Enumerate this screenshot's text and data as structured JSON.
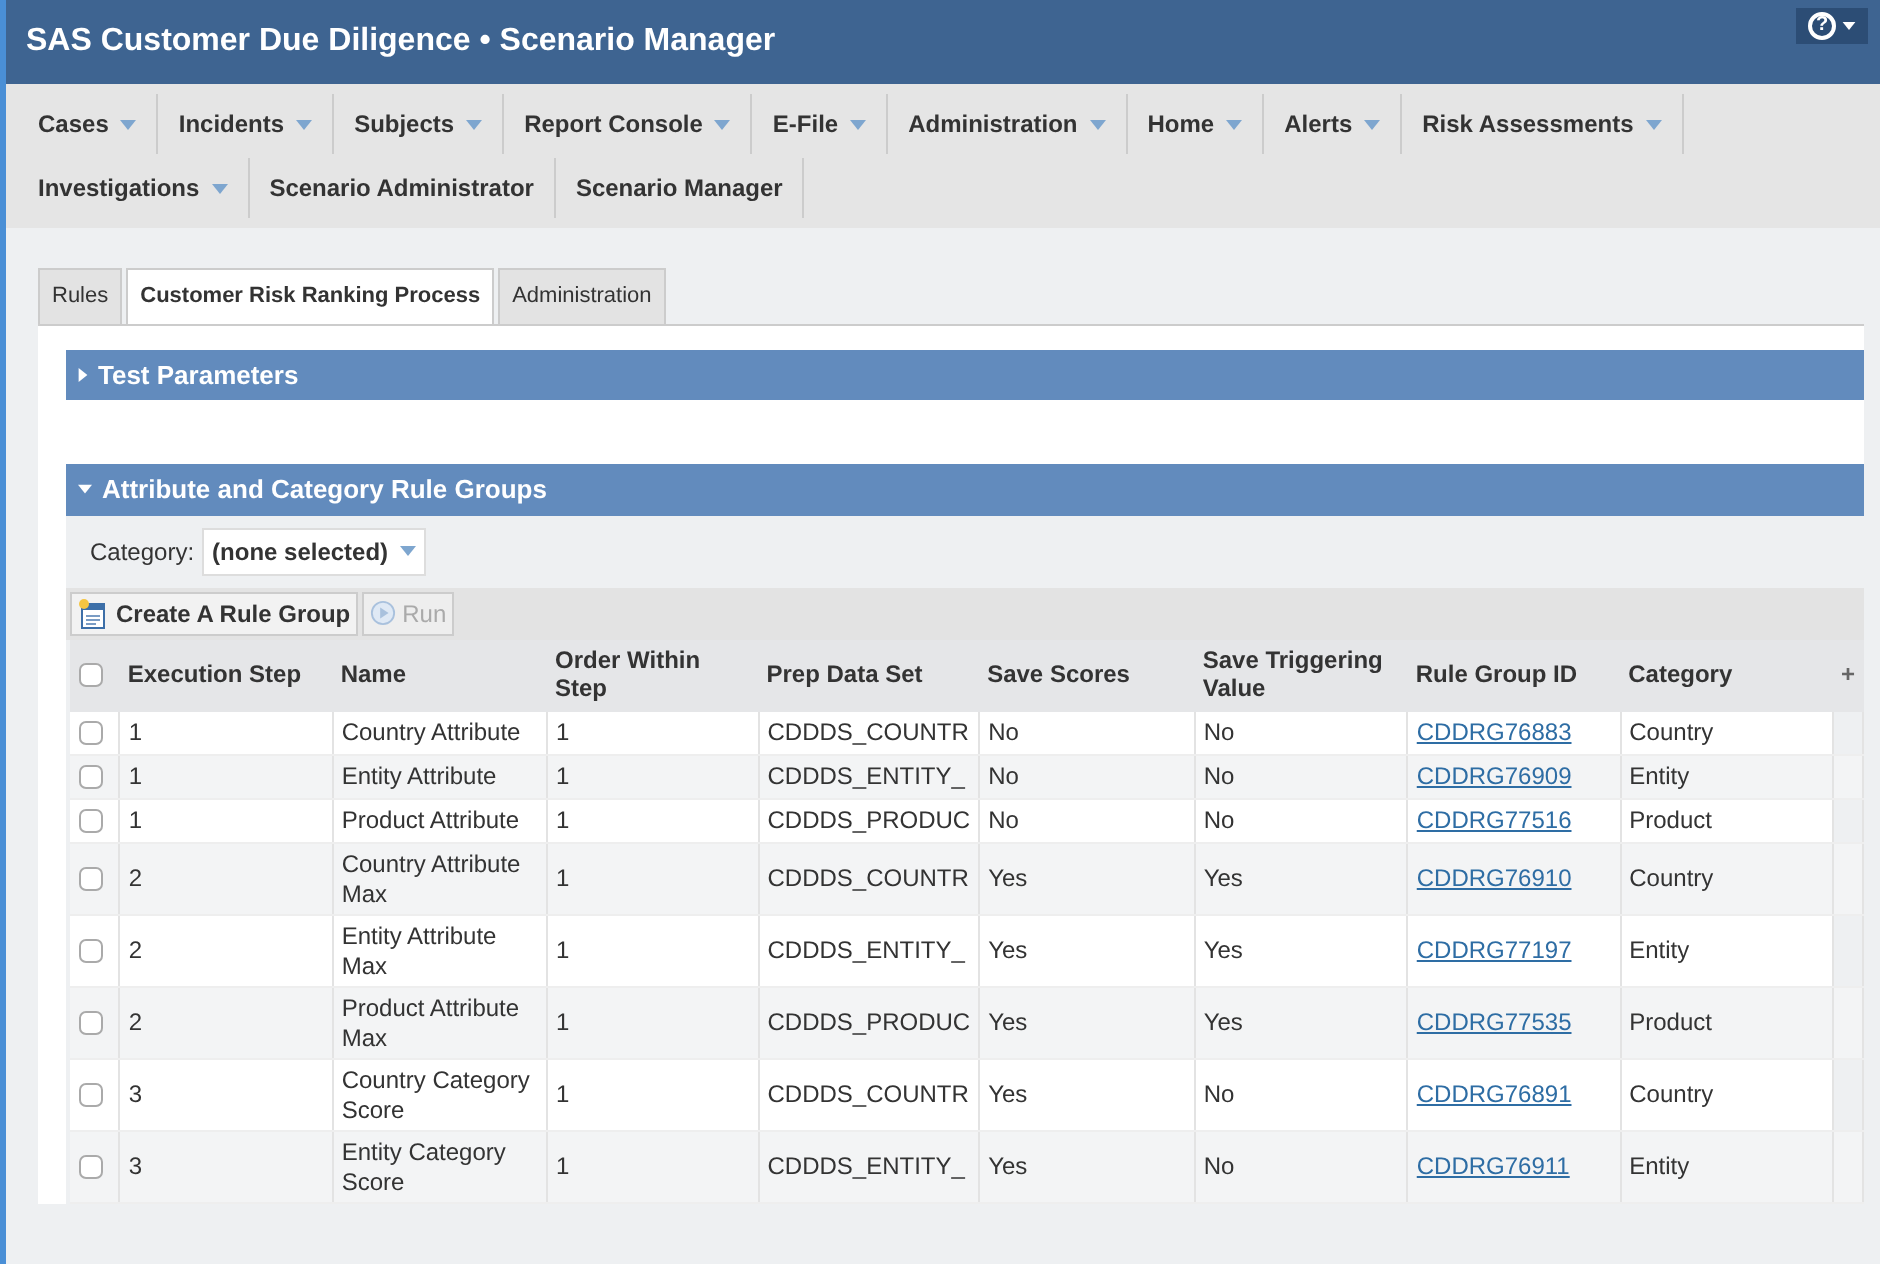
{
  "window": {
    "title": "SAS Customer Due Diligence • Scenario Manager"
  },
  "help_menu": {
    "label": "?"
  },
  "menu": [
    {
      "label": "Cases",
      "dropdown": true
    },
    {
      "label": "Incidents",
      "dropdown": true
    },
    {
      "label": "Subjects",
      "dropdown": true
    },
    {
      "label": "Report Console",
      "dropdown": true
    },
    {
      "label": "E-File",
      "dropdown": true
    },
    {
      "label": "Administration",
      "dropdown": true
    },
    {
      "label": "Home",
      "dropdown": true
    },
    {
      "label": "Alerts",
      "dropdown": true
    },
    {
      "label": "Risk Assessments",
      "dropdown": true
    },
    {
      "label": "Investigations",
      "dropdown": true
    },
    {
      "label": "Scenario Administrator",
      "dropdown": false
    },
    {
      "label": "Scenario Manager",
      "dropdown": false
    }
  ],
  "tabs": [
    {
      "label": "Rules",
      "selected": false
    },
    {
      "label": "Customer Risk Ranking Process",
      "selected": true
    },
    {
      "label": "Administration",
      "selected": false
    }
  ],
  "panels": [
    {
      "title": "Test Parameters",
      "expanded": false
    },
    {
      "title": "Attribute and Category Rule Groups",
      "expanded": true
    }
  ],
  "filter": {
    "label": "Category:",
    "value": "(none selected)"
  },
  "toolbar": [
    {
      "kind": "create",
      "label": "Create A Rule Group",
      "disabled": false
    },
    {
      "kind": "run",
      "label": "Run",
      "disabled": true
    }
  ],
  "table": {
    "columns": [
      "Execution Step",
      "Name",
      "Order Within Step",
      "Prep Data Set",
      "Save Scores",
      "Save Triggering Value",
      "Rule Group ID",
      "Category"
    ],
    "add_column": "+",
    "select_all_checked": false,
    "rows": [
      {
        "checked": false,
        "cells": [
          "1",
          "Country Attribute",
          "1",
          "CDDDS_COUNTR",
          "No",
          "No",
          "CDDRG76883",
          "Country"
        ]
      },
      {
        "checked": false,
        "cells": [
          "1",
          "Entity Attribute",
          "1",
          "CDDDS_ENTITY_",
          "No",
          "No",
          "CDDRG76909",
          "Entity"
        ]
      },
      {
        "checked": false,
        "cells": [
          "1",
          "Product Attribute",
          "1",
          "CDDDS_PRODUC",
          "No",
          "No",
          "CDDRG77516",
          "Product"
        ]
      },
      {
        "checked": false,
        "cells": [
          "2",
          "Country Attribute Max",
          "1",
          "CDDDS_COUNTR",
          "Yes",
          "Yes",
          "CDDRG76910",
          "Country"
        ]
      },
      {
        "checked": false,
        "cells": [
          "2",
          "Entity Attribute Max",
          "1",
          "CDDDS_ENTITY_",
          "Yes",
          "Yes",
          "CDDRG77197",
          "Entity"
        ]
      },
      {
        "checked": false,
        "cells": [
          "2",
          "Product Attribute Max",
          "1",
          "CDDDS_PRODUC",
          "Yes",
          "Yes",
          "CDDRG77535",
          "Product"
        ]
      },
      {
        "checked": false,
        "cells": [
          "3",
          "Country Category Score",
          "1",
          "CDDDS_COUNTR",
          "Yes",
          "No",
          "CDDRG76891",
          "Country"
        ]
      },
      {
        "checked": false,
        "cells": [
          "3",
          "Entity Category Score",
          "1",
          "CDDDS_ENTITY_",
          "Yes",
          "No",
          "CDDRG76911",
          "Entity"
        ]
      }
    ]
  }
}
